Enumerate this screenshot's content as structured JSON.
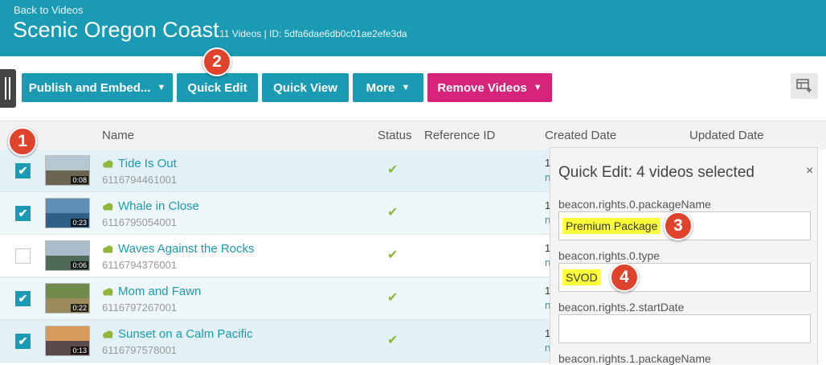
{
  "header": {
    "back_link": "Back to Videos",
    "title": "Scenic Oregon Coast",
    "meta": "11 Videos | ID: 5dfa6dae6db0c01ae2efe3da"
  },
  "toolbar": {
    "publish_label": "Publish and Embed...",
    "quick_edit_label": "Quick Edit",
    "quick_view_label": "Quick View",
    "more_label": "More",
    "remove_label": "Remove Videos",
    "caret": "▼",
    "colors": {
      "teal": "#1a9bb3",
      "pink": "#d6247a"
    }
  },
  "table": {
    "columns": {
      "name": "Name",
      "status": "Status",
      "reference_id": "Reference ID",
      "created_date": "Created Date",
      "updated_date": "Updated Date"
    },
    "rows": [
      {
        "checked": true,
        "duration": "0:08",
        "name": "Tide Is Out",
        "id": "6116794461001",
        "status": "✔",
        "created_partial": "1",
        "created_partial_sub": "n"
      },
      {
        "checked": true,
        "duration": "0:23",
        "name": "Whale in Close",
        "id": "6116795054001",
        "status": "✔",
        "created_partial": "1",
        "created_partial_sub": "n"
      },
      {
        "checked": false,
        "duration": "0:06",
        "name": "Waves Against the Rocks",
        "id": "6116794376001",
        "status": "✔",
        "created_partial": "1",
        "created_partial_sub": "n"
      },
      {
        "checked": true,
        "duration": "0:22",
        "name": "Mom and Fawn",
        "id": "6116797267001",
        "status": "✔",
        "created_partial": "1",
        "created_partial_sub": "n"
      },
      {
        "checked": true,
        "duration": "0:13",
        "name": "Sunset on a Calm Pacific",
        "id": "6116797578001",
        "status": "✔",
        "created_partial": "1",
        "created_partial_sub": "n"
      }
    ],
    "checkmark": "✔"
  },
  "quick_edit": {
    "title": "Quick Edit: 4 videos selected",
    "close": "×",
    "fields": [
      {
        "label": "beacon.rights.0.packageName",
        "value": "Premium Package"
      },
      {
        "label": "beacon.rights.0.type",
        "value": "SVOD"
      },
      {
        "label": "beacon.rights.2.startDate",
        "value": ""
      },
      {
        "label": "beacon.rights.1.packageName",
        "value": ""
      }
    ]
  },
  "callouts": [
    "1",
    "2",
    "3",
    "4"
  ],
  "icons": {
    "left_handle": "sidebar-handle-icon",
    "table_settings": "table-add-column-icon",
    "cloud": "cloud-icon"
  }
}
